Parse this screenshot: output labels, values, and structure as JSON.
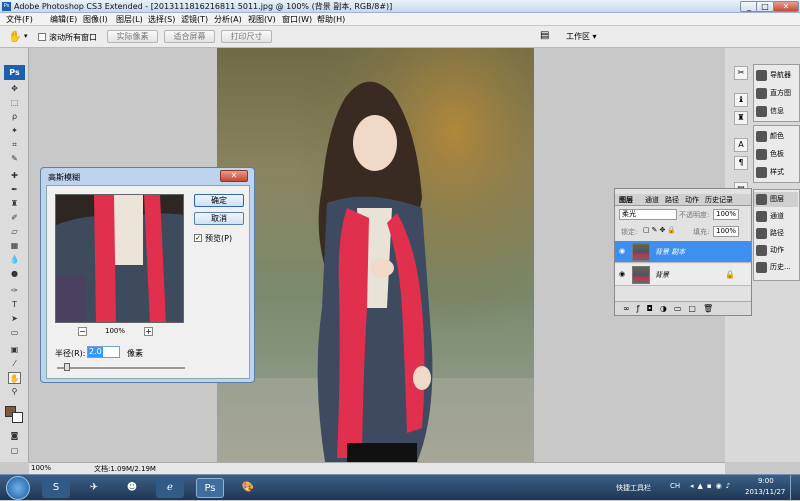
{
  "window": {
    "title": "Adobe Photoshop CS3 Extended - [2013111816216811 5011.jpg @ 100% (背景 副本, RGB/8#)]",
    "app_badge": "Ps",
    "minimize": "_",
    "maximize": "□",
    "close": "✕"
  },
  "menu": [
    "文件(F)",
    "编辑(E)",
    "图像(I)",
    "图层(L)",
    "选择(S)",
    "滤镜(T)",
    "分析(A)",
    "视图(V)",
    "窗口(W)",
    "帮助(H)"
  ],
  "options": {
    "checkbox_label": "滚动所有窗口",
    "btn_actual": "实际像素",
    "btn_fit": "适合屏幕",
    "btn_print": "打印尺寸",
    "workspace": "工作区 ▾"
  },
  "toolbox": {
    "logo": "Ps"
  },
  "status": {
    "zoom": "100%",
    "doc": "文档:1.09M/2.19M"
  },
  "dialog": {
    "title": "高斯模糊",
    "close": "✕",
    "ok": "确定",
    "cancel": "取消",
    "preview_label": "预览(P)",
    "zoom_minus": "−",
    "zoom_value": "100%",
    "zoom_plus": "+",
    "radius_label": "半径(R):",
    "radius_value": "2.0",
    "unit": "像素",
    "preview_checked": true
  },
  "layers_panel": {
    "tabs": [
      "图层",
      "通道",
      "路径",
      "动作",
      "历史记录"
    ],
    "blend_mode": "柔光",
    "opacity_label": "不透明度:",
    "opacity_value": "100%",
    "lock_label": "锁定:",
    "fill_label": "填充:",
    "fill_value": "100%",
    "layers": [
      {
        "name": "背景 副本",
        "selected": true
      },
      {
        "name": "背景",
        "selected": false
      }
    ],
    "footer_icons": [
      "link-icon",
      "fx-icon",
      "mask-icon",
      "adjustment-icon",
      "folder-icon",
      "new-layer-icon",
      "trash-icon"
    ]
  },
  "side_panels": {
    "group1": [
      "导航器",
      "直方图",
      "信息"
    ],
    "group2": [
      "颜色",
      "色板",
      "样式"
    ],
    "group3": [
      "图层",
      "通道",
      "路径",
      "动作",
      "历史..."
    ]
  },
  "taskbar": {
    "quicklaunch_label": "快捷工具栏",
    "tray_ime": "CH",
    "time": "9:00",
    "date": "2013/11/27"
  }
}
